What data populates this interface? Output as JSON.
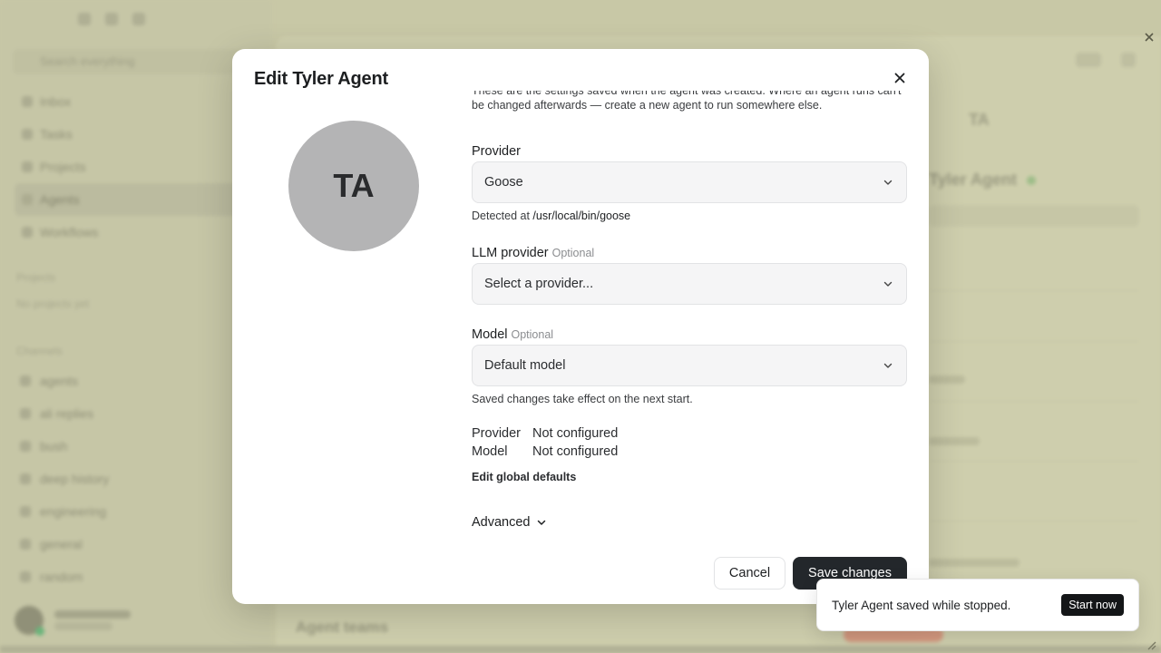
{
  "background": {
    "search_placeholder": "Search everything",
    "nav": [
      "Inbox",
      "Tasks",
      "Projects",
      "Agents",
      "Workflows"
    ],
    "projects_section": "Projects",
    "projects_empty": "No projects yet",
    "channels_section": "Channels",
    "channels": [
      "agents",
      "ali replies",
      "bush",
      "deep history",
      "engineering",
      "general",
      "random"
    ],
    "user_name": "sgaddinwick",
    "right_title_initials": "TA",
    "right_name": "Tyler Agent",
    "bottom_title": "Agent teams"
  },
  "modal": {
    "title": "Edit Tyler Agent",
    "avatar_initials": "TA",
    "intro": "These are the settings saved when the agent was created. Where an agent runs can't be changed afterwards — create a new agent to run somewhere else.",
    "provider": {
      "label": "Provider",
      "value": "Goose",
      "detected_prefix": "Detected at",
      "detected_path": "/usr/local/bin/goose"
    },
    "llm_provider": {
      "label": "LLM provider",
      "optional": "Optional",
      "placeholder": "Select a provider..."
    },
    "model": {
      "label": "Model",
      "optional": "Optional",
      "value": "Default model",
      "hint": "Saved changes take effect on the next start."
    },
    "defaults": {
      "provider_key": "Provider",
      "provider_value": "Not configured",
      "model_key": "Model",
      "model_value": "Not configured",
      "edit_link": "Edit global defaults"
    },
    "advanced_label": "Advanced",
    "cancel_label": "Cancel",
    "save_label": "Save changes"
  },
  "toast": {
    "message": "Tyler Agent saved while stopped.",
    "action": "Start now"
  }
}
